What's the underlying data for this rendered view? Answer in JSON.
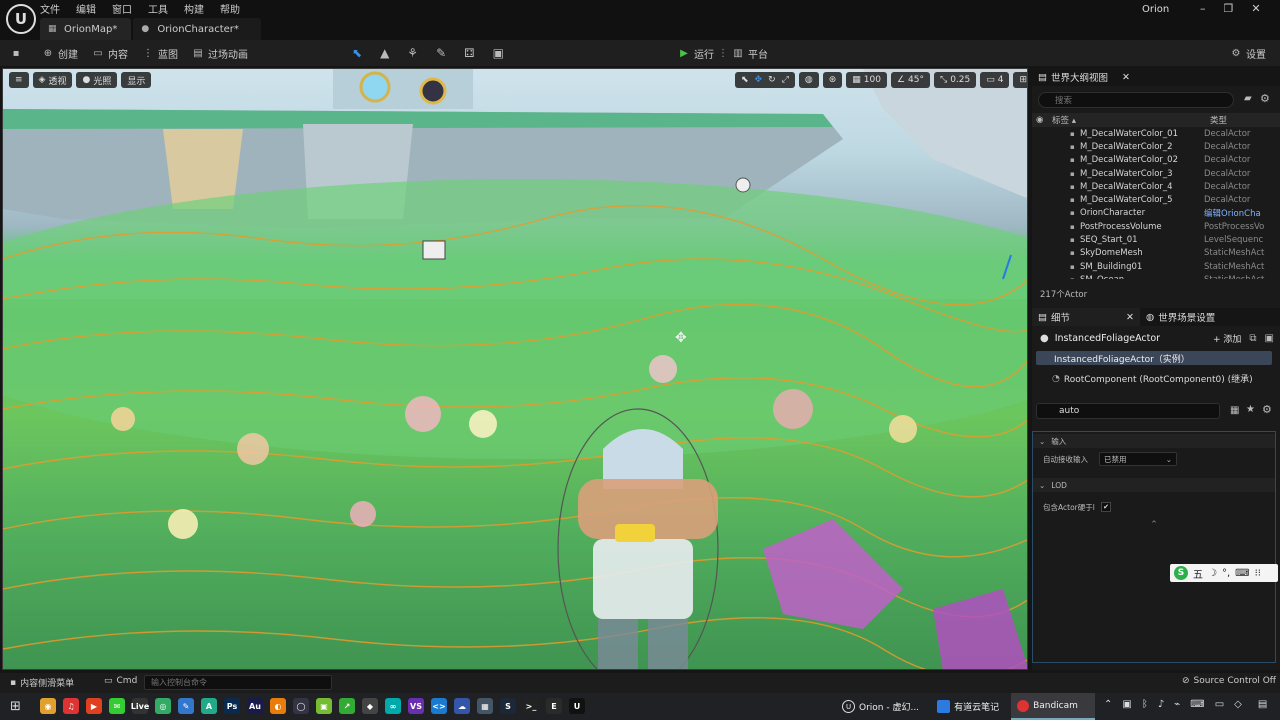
{
  "app": {
    "user_name": "Orion",
    "menu": [
      "文件",
      "编辑",
      "窗口",
      "工具",
      "构建",
      "帮助"
    ],
    "tabs": [
      {
        "label": "OrionMap*",
        "active": true
      },
      {
        "label": "OrionCharacter*",
        "active": false
      }
    ],
    "window_controls": [
      "–",
      "❐",
      "✕"
    ]
  },
  "toolbar": {
    "save_icon": "save-icon",
    "create_label": "创建",
    "content_label": "内容",
    "blueprint_label": "蓝图",
    "cinematics_label": "过场动画",
    "play_label": "运行",
    "platform_label": "平台",
    "settings_label": "设置"
  },
  "viewport": {
    "perspective_label": "透视",
    "lighting_label": "光照",
    "show_label": "显示",
    "grid_snap_value": "100",
    "rotation_snap_value": "45°",
    "scale_snap_value": "0.25",
    "camera_speed_value": "4"
  },
  "outliner": {
    "tab_label": "世界大纲视图",
    "search_placeholder": "搜索",
    "col_label": "标签 ▴",
    "col_type": "类型",
    "rows": [
      {
        "name": "M_DecalWaterColor_01",
        "type": "DecalActor",
        "link": false
      },
      {
        "name": "M_DecalWaterColor_2",
        "type": "DecalActor",
        "link": false
      },
      {
        "name": "M_DecalWaterColor_02",
        "type": "DecalActor",
        "link": false
      },
      {
        "name": "M_DecalWaterColor_3",
        "type": "DecalActor",
        "link": false
      },
      {
        "name": "M_DecalWaterColor_4",
        "type": "DecalActor",
        "link": false
      },
      {
        "name": "M_DecalWaterColor_5",
        "type": "DecalActor",
        "link": false
      },
      {
        "name": "OrionCharacter",
        "type": "编辑OrionCha",
        "link": true
      },
      {
        "name": "PostProcessVolume",
        "type": "PostProcessVo",
        "link": false
      },
      {
        "name": "SEQ_Start_01",
        "type": "LevelSequenc",
        "link": false
      },
      {
        "name": "SkyDomeMesh",
        "type": "StaticMeshAct",
        "link": false
      },
      {
        "name": "SM_Building01",
        "type": "StaticMeshAct",
        "link": false
      },
      {
        "name": "SM_Ocean",
        "type": "StaticMeshAct",
        "link": false
      }
    ],
    "actor_count": "217个Actor"
  },
  "details": {
    "tab_label": "细节",
    "world_settings_label": "世界场景设置",
    "actor_name": "InstancedFoliageActor",
    "add_label": "+ 添加",
    "selected_component": "InstancedFoliageActor（实例）",
    "root_component": "RootComponent (RootComponent0) (继承)",
    "search_value": "auto",
    "section_input": "输入",
    "auto_receive_input_label": "自动接收输入",
    "auto_receive_input_value": "已禁用",
    "section_lod": "LOD",
    "include_actor_label": "包含Actor硬于l",
    "include_actor_checked": "✔"
  },
  "bottom": {
    "content_drawer_label": "内容侧滑菜单",
    "cmd_label": "Cmd",
    "cmd_placeholder": "输入控制台命令",
    "source_control_label": "Source Control Off"
  },
  "ime": {
    "mode_label": "五",
    "icons": [
      "☽",
      "°,",
      "⌨",
      "⁝⁝"
    ]
  },
  "taskbar": {
    "pinned": [
      {
        "icon": "chrome-icon",
        "color": "#e0a030",
        "glyph": "◉"
      },
      {
        "icon": "netease-music-icon",
        "color": "#d33",
        "glyph": "♫"
      },
      {
        "icon": "red-app-icon",
        "color": "#e04020",
        "glyph": "▶"
      },
      {
        "icon": "wechat-icon",
        "color": "#3c3",
        "glyph": "✉"
      },
      {
        "icon": "live-icon",
        "color": "#333",
        "glyph": "Live"
      },
      {
        "icon": "camera-icon",
        "color": "#3a6",
        "glyph": "◎"
      },
      {
        "icon": "notes-icon",
        "color": "#37c",
        "glyph": "✎"
      },
      {
        "icon": "arch-icon",
        "color": "#2a8",
        "glyph": "A"
      },
      {
        "icon": "photoshop-icon",
        "color": "#0a2b4f",
        "glyph": "Ps"
      },
      {
        "icon": "audition-icon",
        "color": "#1a1a4a",
        "glyph": "Au"
      },
      {
        "icon": "blender-icon",
        "color": "#e87d0d",
        "glyph": "◐"
      },
      {
        "icon": "obs-icon",
        "color": "#334",
        "glyph": "◯"
      },
      {
        "icon": "green-app-icon",
        "color": "#7b3",
        "glyph": "▣"
      },
      {
        "icon": "share-icon",
        "color": "#3a3",
        "glyph": "↗"
      },
      {
        "icon": "git-icon",
        "color": "#444",
        "glyph": "◆"
      },
      {
        "icon": "arduino-icon",
        "color": "#0aa",
        "glyph": "∞"
      },
      {
        "icon": "visual-studio-icon",
        "color": "#6a2fb0",
        "glyph": "VS"
      },
      {
        "icon": "vscode-icon",
        "color": "#1a7ad0",
        "glyph": "<>"
      },
      {
        "icon": "cloud-icon",
        "color": "#35a",
        "glyph": "☁"
      },
      {
        "icon": "calculator-icon",
        "color": "#456",
        "glyph": "▦"
      },
      {
        "icon": "steam-icon",
        "color": "#1b2838",
        "glyph": "S"
      },
      {
        "icon": "terminal-icon",
        "color": "#222",
        "glyph": ">_"
      },
      {
        "icon": "epic-icon",
        "color": "#2a2a2a",
        "glyph": "E"
      },
      {
        "icon": "unreal-icon",
        "color": "#111",
        "glyph": "U"
      }
    ],
    "windows": [
      {
        "label": "Orion - 虚幻...",
        "icon": "unreal-window-icon",
        "active": false
      },
      {
        "label": "有道云笔记",
        "icon": "youdao-icon",
        "active": false
      },
      {
        "label": "Bandicam",
        "icon": "bandicam-icon",
        "active": true
      }
    ]
  }
}
